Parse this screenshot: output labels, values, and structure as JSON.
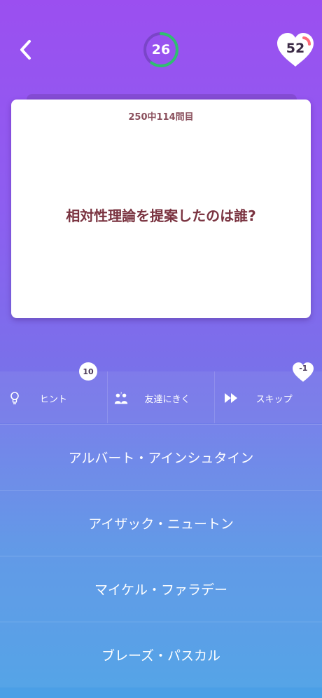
{
  "header": {
    "timer_value": "26",
    "timer_fraction": 0.6,
    "lives_value": "52",
    "colors": {
      "timer_ring": "#2fbf71",
      "timer_track": "#7a45c8",
      "heart_fill": "#ffffff"
    }
  },
  "card": {
    "progress": "250中114問目",
    "question": "相対性理論を提案したのは誰?"
  },
  "tools": [
    {
      "label": "ヒント",
      "icon": "lightbulb-icon",
      "badge": "10"
    },
    {
      "label": "友達にきく",
      "icon": "ask-friends-icon"
    },
    {
      "label": "スキップ",
      "icon": "fast-forward-icon",
      "badge": "-1"
    }
  ],
  "answers": [
    {
      "label": "アルバート・アインシュタイン"
    },
    {
      "label": "アイザック・ニュートン"
    },
    {
      "label": "マイケル・ファラデー"
    },
    {
      "label": "ブレーズ・パスカル"
    }
  ]
}
